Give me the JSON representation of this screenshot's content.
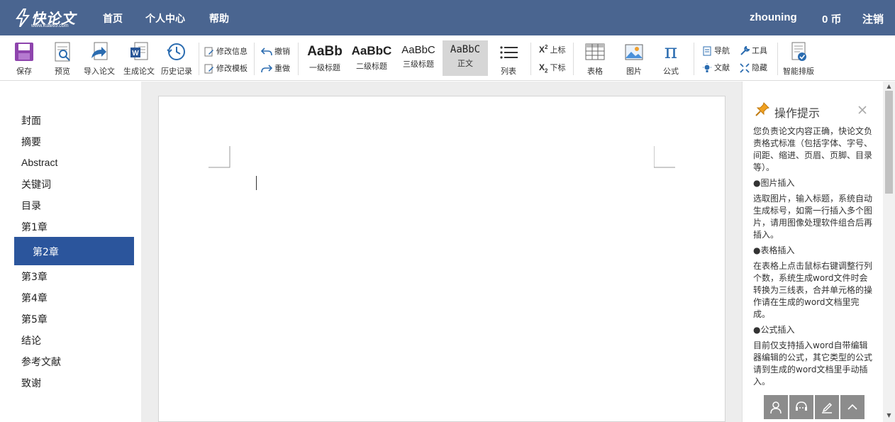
{
  "header": {
    "logo_text": "快论文",
    "logo_url": "www.kuai65.com",
    "nav": [
      "首页",
      "个人中心",
      "帮助"
    ],
    "username": "zhouning",
    "coins": "0 币",
    "logout": "注销"
  },
  "toolbar": {
    "save": "保存",
    "preview": "预览",
    "import": "导入论文",
    "generate": "生成论文",
    "history": "历史记录",
    "edit_info": "修改信息",
    "edit_template": "修改模板",
    "undo": "撤销",
    "redo": "重做",
    "styles": [
      {
        "sample": "AaBb",
        "label": "一级标题"
      },
      {
        "sample": "AaBbC",
        "label": "二级标题"
      },
      {
        "sample": "AaBbC",
        "label": "三级标题"
      },
      {
        "sample": "AaBbC",
        "label": "正文"
      }
    ],
    "list": "列表",
    "superscript": "上标",
    "subscript": "下标",
    "sup_glyph": "X",
    "sup_num": "2",
    "table": "表格",
    "image": "图片",
    "formula": "公式",
    "formula_glyph": "π",
    "navigation": "导航",
    "tools": "工具",
    "references": "文献",
    "hide": "隐藏",
    "smart_format": "智能排版"
  },
  "outline": {
    "items": [
      "封面",
      "摘要",
      "Abstract",
      "关键词",
      "目录",
      "第1章",
      "第2章",
      "第3章",
      "第4章",
      "第5章",
      "结论",
      "参考文献",
      "致谢"
    ],
    "active": "第2章"
  },
  "tips": {
    "title": "操作提示",
    "intro": "您负责论文内容正确，快论文负责格式标准（包括字体、字号、间距、缩进、页眉、页脚、目录等）。",
    "image_heading": "●图片插入",
    "image_text": "选取图片，输入标题，系统自动生成标号，如需一行插入多个图片，请用图像处理软件组合后再插入。",
    "table_heading": "●表格插入",
    "table_text": "在表格上点击鼠标右键调整行列个数，系统生成word文件时会转换为三线表，合并单元格的操作请在生成的word文档里完成。",
    "formula_heading": "●公式插入",
    "formula_text": "目前仅支持插入word自带编辑器编辑的公式，其它类型的公式请到生成的word文档里手动插入。"
  },
  "colors": {
    "header_bg": "#4a6590",
    "active_outline": "#2b559c",
    "save_icon": "#8e44ad"
  }
}
